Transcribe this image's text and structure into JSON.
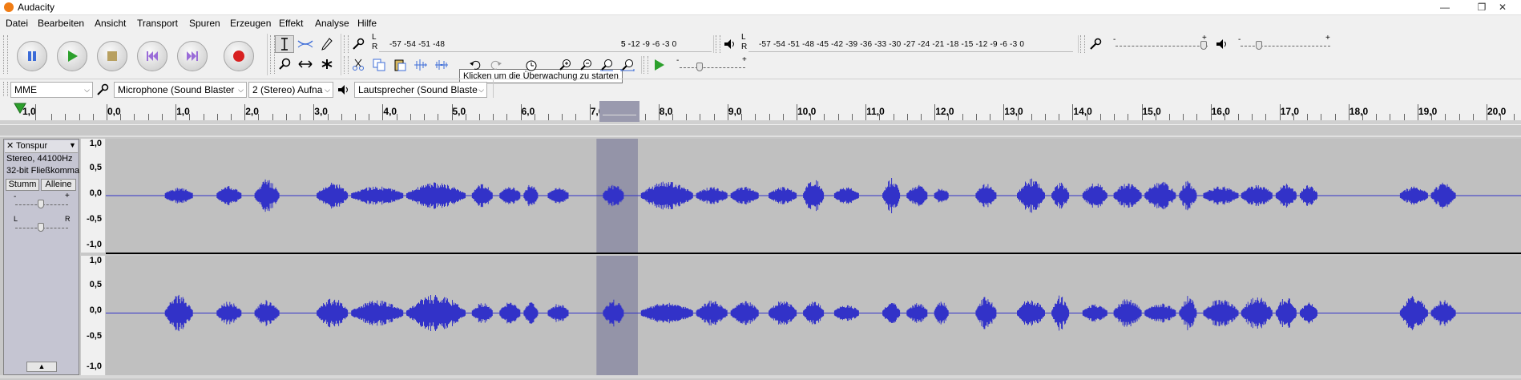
{
  "window": {
    "title": "Audacity",
    "controls": [
      "—",
      "❐",
      "✕"
    ]
  },
  "menu": [
    "Datei",
    "Bearbeiten",
    "Ansicht",
    "Transport",
    "Spuren",
    "Erzeugen",
    "Effekt",
    "Analyse",
    "Hilfe"
  ],
  "meters": {
    "record_scale": "-57 -54 -51 -48 -45 -42 -39 -36 -33 -30 -27 -24 -21 -18 -15 -12 -9 -6 -3 0",
    "record_scale_right": "5 -12  -9  -6  -3  0",
    "record_scale_left": "-57 -54 -51 -48",
    "play_scale": "-57 -54 -51 -48 -45 -42 -39 -36 -33 -30 -27 -24 -21 -18 -15 -12  -9  -6  -3  0",
    "lr_top": "L",
    "lr_bottom": "R",
    "tooltip": "Klicken um die Überwachung zu starten"
  },
  "sliders": {
    "minus": "-",
    "plus": "+"
  },
  "devices": {
    "host": "MME",
    "input": "Microphone (Sound Blaster",
    "channels": "2 (Stereo) Aufna",
    "output": "Lautsprecher (Sound Blaste"
  },
  "ruler": {
    "labels": [
      "1,0",
      "0,0",
      "1,0",
      "2,0",
      "3,0",
      "4,0",
      "5,0",
      "6,0",
      "7,0",
      "8,0",
      "9,0",
      "10,0",
      "11,0",
      "12,0",
      "13,0",
      "14,0",
      "15,0",
      "16,0",
      "17,0",
      "18,0",
      "19,0",
      "20,0"
    ]
  },
  "track": {
    "name": "Tonspur",
    "info1": "Stereo, 44100Hz",
    "info2": "32-bit Fließkomma",
    "mute": "Stumm",
    "solo": "Alleine",
    "gain_minus": "-",
    "gain_plus": "+",
    "pan_left": "L",
    "pan_right": "R",
    "collapse": "▲",
    "close": "✕",
    "menu_arrow": "▼"
  },
  "vruler": [
    "1,0",
    "0,5",
    "0,0",
    "-0,5",
    "-1,0"
  ],
  "selection": {
    "start": 7.1,
    "end": 7.7
  },
  "colors": {
    "waveform": "#3232c8",
    "selection": "#9494a8",
    "play": "#2ca02c",
    "record": "#d82020"
  }
}
